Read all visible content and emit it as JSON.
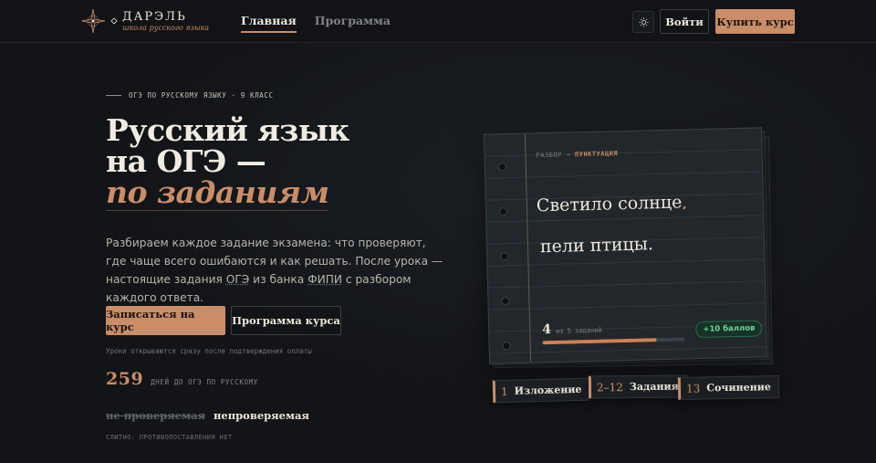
{
  "header": {
    "logo": {
      "title": "ДАРЭЛЬ",
      "subtitle": "школа русского языка"
    },
    "nav": [
      {
        "label": "Главная",
        "active": true
      },
      {
        "label": "Программа",
        "active": false
      }
    ],
    "theme_icon": "sun-icon",
    "login_label": "Войти",
    "buy_label": "Купить курс"
  },
  "hero": {
    "eyebrow": "ОГЭ ПО РУССКОМУ ЯЗЫКУ · 9 КЛАСС",
    "title_line1": "Русский язык",
    "title_line2": "на ОГЭ —",
    "title_accent": "по заданиям",
    "lead_part1": "Разбираем каждое задание экзамена: что проверяют, где чаще всего ошибаются и как решать. После урока — настоящие задания ",
    "lead_u1": "ОГЭ",
    "lead_part2": " из банка ",
    "lead_u2": "ФИПИ",
    "lead_part3": " с разбором каждого ответа.",
    "cta_primary": "Записаться на курс",
    "cta_secondary": "Программа курса",
    "note": "Уроки открываются сразу после подтверждения оплаты",
    "counter_value": "259",
    "counter_label": "ДНЕЙ ДО ОГЭ ПО РУССКОМУ",
    "spelling_wrong": "не проверяемая",
    "spelling_right": "непроверяемая",
    "rule_note": "СЛИТНО: ПРОТИВОПОСТАВЛЕНИЯ НЕТ"
  },
  "card": {
    "crumb_prefix": "РАЗБОР →",
    "crumb_topic": "ПУНКТУАЦИЯ",
    "line1": "Светило солнце",
    "line1_mark": ",,",
    "line2": "пели птицы.",
    "progress_value": "4",
    "progress_label": "из 5 заданий",
    "progress_fraction": 0.8,
    "score_badge": "+10 баллов"
  },
  "tags": [
    {
      "num": "1",
      "label": "Изложение"
    },
    {
      "num": "2–12",
      "label": "Задания"
    },
    {
      "num": "13",
      "label": "Сочинение"
    }
  ],
  "colors": {
    "background": "#121417",
    "accent": "#c98d68",
    "progress": "#d47f52",
    "success": "#6fd3a0"
  }
}
